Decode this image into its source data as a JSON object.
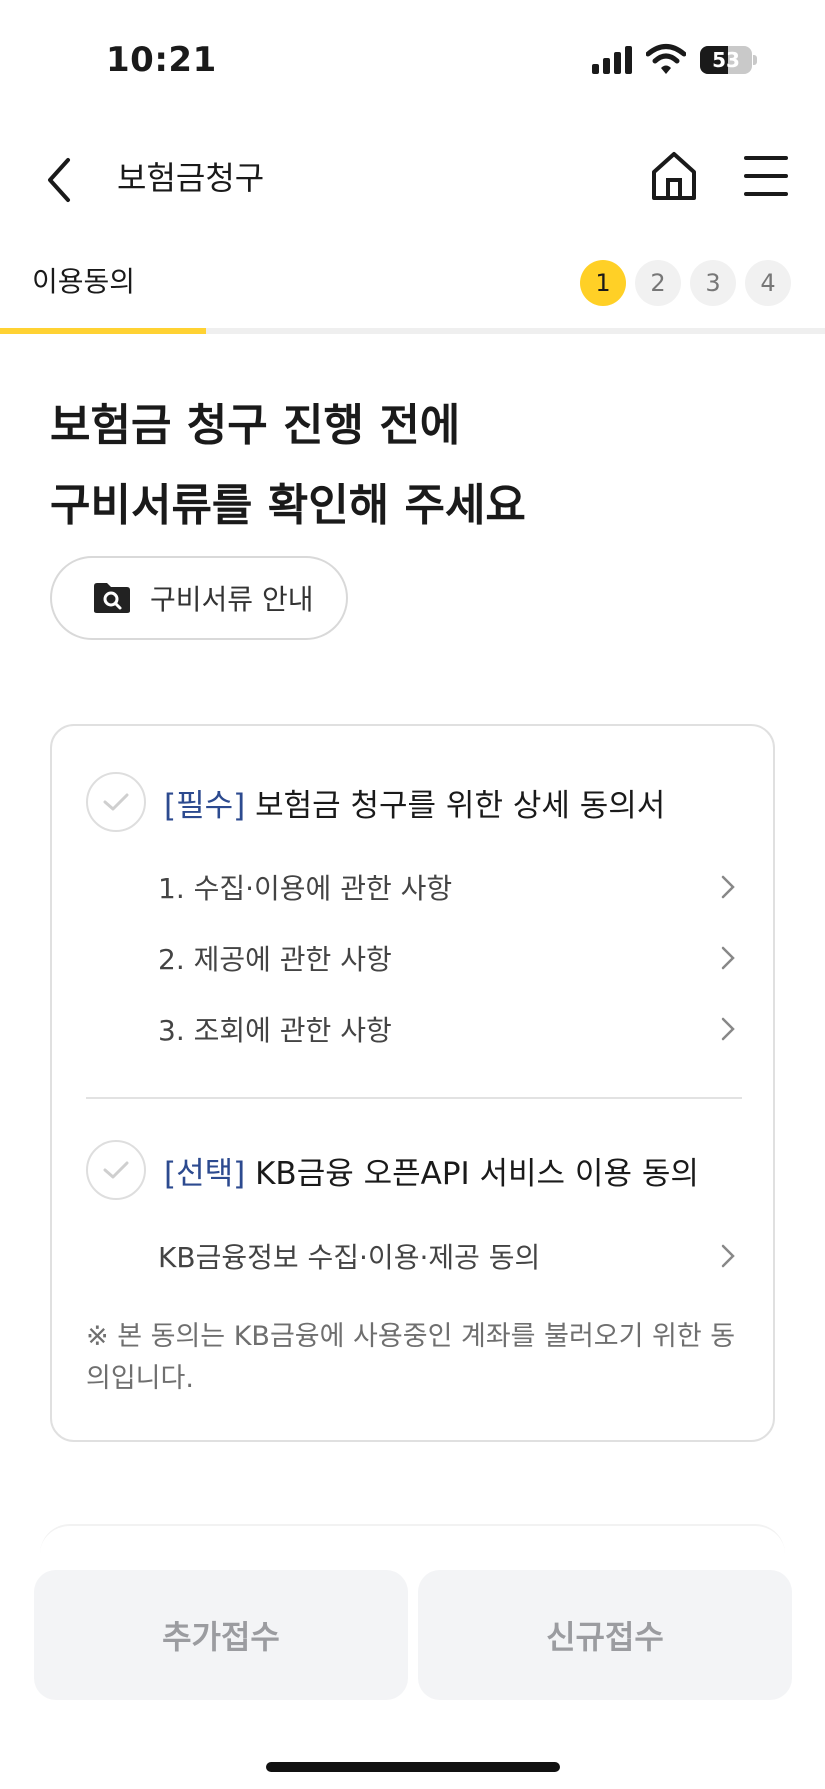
{
  "status_bar": {
    "time": "10:21",
    "battery_level": "53",
    "battery_fraction": 0.53
  },
  "header": {
    "title": "보험금청구",
    "icons": {
      "back": "chevron-left-icon",
      "home": "home-icon",
      "menu": "hamburger-menu-icon"
    }
  },
  "steps": {
    "current_label": "이용동의",
    "items": [
      "1",
      "2",
      "3",
      "4"
    ],
    "active_index": 0,
    "progress_fraction": 0.25
  },
  "main": {
    "heading_line1": "보험금 청구 진행 전에",
    "heading_line2": "구비서류를 확인해 주세요",
    "docs_button_label": "구비서류 안내"
  },
  "consents": {
    "required": {
      "tag": "[필수]",
      "title": "보험금 청구를 위한 상세 동의서",
      "items": [
        "1. 수집·이용에 관한 사항",
        "2. 제공에 관한 사항",
        "3. 조회에 관한 사항"
      ]
    },
    "optional": {
      "tag": "[선택]",
      "title": "KB금융 오픈API 서비스 이용 동의",
      "items": [
        "KB금융정보 수집·이용·제공 동의"
      ]
    },
    "note": "※ 본 동의는 KB금융에 사용중인 계좌를 불러오기 위한 동의입니다."
  },
  "bottom_buttons": {
    "left": "추가접수",
    "right": "신규접수"
  },
  "colors": {
    "accent_yellow": "#ffd026",
    "tag_blue": "#2c4a8f",
    "button_bg": "#f3f4f6"
  }
}
